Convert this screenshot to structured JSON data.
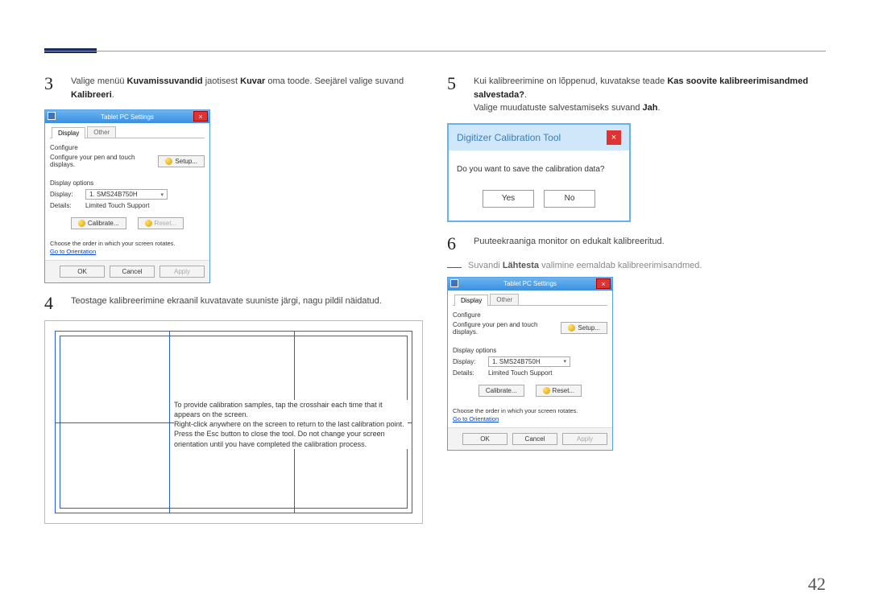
{
  "page_number": "42",
  "left": {
    "step3": {
      "parts": [
        {
          "text": "Valige menüü ",
          "b": false
        },
        {
          "text": "Kuvamissuvandid",
          "b": true
        },
        {
          "text": " jaotisest ",
          "b": false
        },
        {
          "text": "Kuvar",
          "b": true
        },
        {
          "text": " oma toode. Seejärel valige suvand ",
          "b": false
        },
        {
          "text": "Kalibreeri",
          "b": true
        },
        {
          "text": ".",
          "b": false
        }
      ]
    },
    "win1": {
      "title": "Tablet PC Settings",
      "tabs": [
        "Display",
        "Other"
      ],
      "configure_title": "Configure",
      "configure_text": "Configure your pen and touch displays.",
      "setup_btn": "Setup...",
      "opts_title": "Display options",
      "display_label": "Display:",
      "display_value": "1. SMS24B750H",
      "details_label": "Details:",
      "details_value": "Limited Touch Support",
      "calibrate_btn": "Calibrate...",
      "reset_btn": "Reset...",
      "order_text": "Choose the order in which your screen rotates.",
      "go_link": "Go to Orientation",
      "footer": {
        "ok": "OK",
        "cancel": "Cancel",
        "apply": "Apply"
      }
    },
    "step4": "Teostage kalibreerimine ekraanil kuvatavate suuniste järgi, nagu pildil näidatud.",
    "cal_text": "To provide calibration samples, tap the crosshair each time that it appears on the screen.\nRight-click anywhere on the screen to return to the last calibration point. Press the Esc button to close the tool. Do not change your screen orientation until you have completed the calibration process."
  },
  "right": {
    "step5": {
      "prefix": "Kui kalibreerimine on lõppenud, kuvatakse teade ",
      "bold": "Kas soovite kalibreerimisandmed salvestada?",
      "suffix": ".",
      "line2_prefix": "Valige muudatuste salvestamiseks suvand ",
      "line2_bold": "Jah",
      "line2_suffix": "."
    },
    "dialog": {
      "title": "Digitizer Calibration Tool",
      "msg": "Do you want to save the calibration data?",
      "yes": "Yes",
      "no": "No"
    },
    "step6": "Puuteekraaniga monitor on edukalt kalibreeritud.",
    "note": {
      "prefix": "Suvandi ",
      "bold": "Lähtesta",
      "suffix": " valimine eemaldab kalibreerimisandmed."
    }
  }
}
